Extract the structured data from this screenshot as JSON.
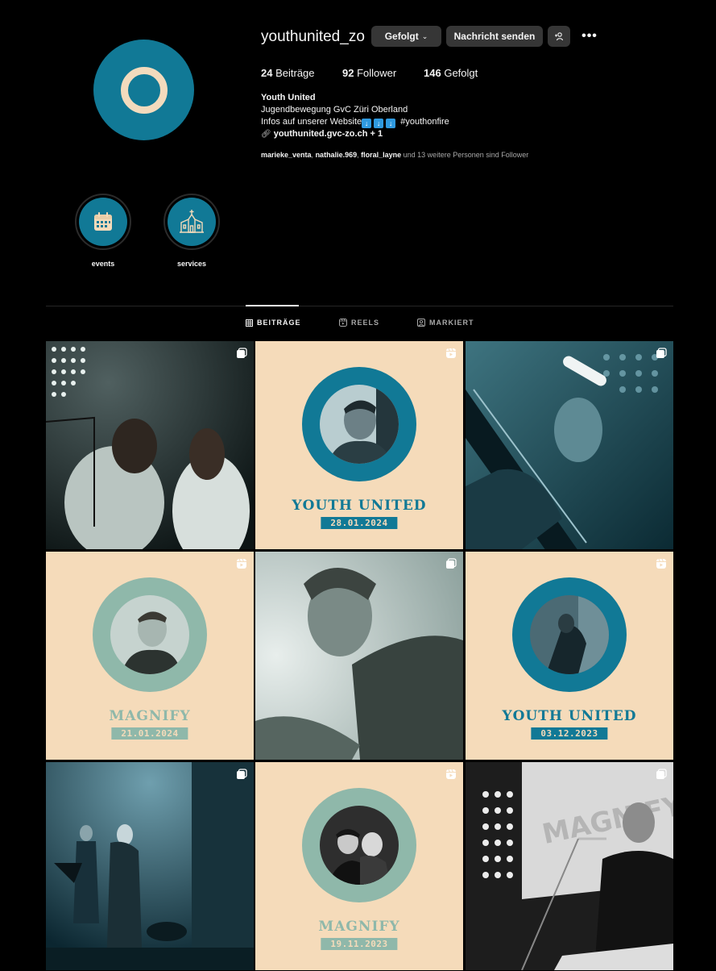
{
  "profile": {
    "username": "youthunited_zo",
    "buttons": {
      "following": "Gefolgt",
      "message": "Nachricht senden"
    },
    "stats": [
      {
        "count": "24",
        "label": "Beiträge"
      },
      {
        "count": "92",
        "label": "Follower"
      },
      {
        "count": "146",
        "label": "Gefolgt"
      }
    ],
    "bio": {
      "name": "Youth United",
      "line1": "Jugendbewegung GvC Züri Oberland",
      "line2": "Infos auf unserer Website",
      "hashtag": "#youthonfire",
      "link": "youthunited.gvc-zo.ch",
      "link_extra": "+ 1"
    },
    "followed_by": {
      "users": [
        "marieke_venta",
        "nathalie.969",
        "floral_layne"
      ],
      "suffix": "und 13 weitere Personen sind Follower"
    }
  },
  "highlights": [
    {
      "label": "events",
      "icon": "calendar-icon"
    },
    {
      "label": "services",
      "icon": "church-icon"
    }
  ],
  "tabs": [
    {
      "label": "BEITRÄGE",
      "icon": "grid-icon",
      "active": true
    },
    {
      "label": "REELS",
      "icon": "reels-icon",
      "active": false
    },
    {
      "label": "MARKIERT",
      "icon": "tagged-icon",
      "active": false
    }
  ],
  "posts": [
    {
      "kind": "photo",
      "type_icon": "carousel-icon"
    },
    {
      "kind": "graphic",
      "type_icon": "reel-icon",
      "title": "YOUTH UNITED",
      "date": "28.01.2024",
      "theme": "#117996"
    },
    {
      "kind": "photo",
      "type_icon": "carousel-icon"
    },
    {
      "kind": "graphic",
      "type_icon": "reel-icon",
      "title": "MAGNIFY",
      "date": "21.01.2024",
      "theme": "#8fb8aa"
    },
    {
      "kind": "photo",
      "type_icon": "carousel-icon"
    },
    {
      "kind": "graphic",
      "type_icon": "reel-icon",
      "title": "YOUTH UNITED",
      "date": "03.12.2023",
      "theme": "#117996"
    },
    {
      "kind": "photo",
      "type_icon": "carousel-icon"
    },
    {
      "kind": "graphic",
      "type_icon": "reel-icon",
      "title": "MAGNIFY",
      "date": "19.11.2023",
      "theme": "#8fb8aa"
    },
    {
      "kind": "photo",
      "type_icon": "carousel-icon"
    }
  ],
  "colors": {
    "brand_teal": "#117996",
    "cream": "#f5dbba",
    "sage": "#8fb8aa",
    "background": "#000000"
  }
}
